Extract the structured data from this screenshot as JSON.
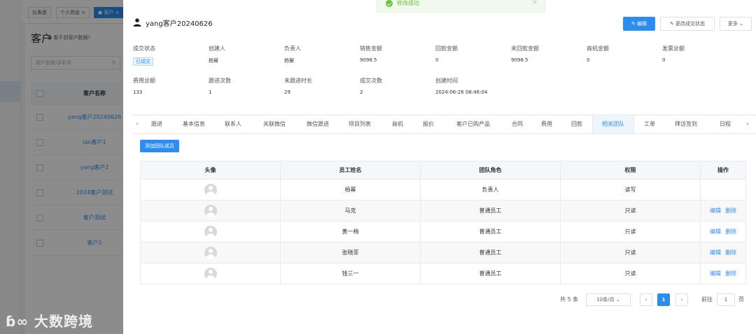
{
  "background": {
    "tabs": [
      "仪表盘",
      "个人信息",
      "客户"
    ],
    "page_title": "客户",
    "hint": "看不到客户数据?",
    "search_placeholder": "客户名称/手机号",
    "table_header": "客户名称",
    "rows": [
      "yang客户20240626",
      "lan客户1",
      "yang客户2",
      "2024客户测试",
      "客户测试",
      "客户1"
    ],
    "watermark": "大数跨境"
  },
  "toast": {
    "text": "修改成功"
  },
  "drawer": {
    "customer_name": "yang客户20240626",
    "buttons": {
      "edit": "编辑",
      "change_status": "更改成交状态",
      "more": "更多"
    },
    "info": [
      {
        "label": "成交状态",
        "value": "已成交",
        "tag": true
      },
      {
        "label": "创建人",
        "value": "杨幂"
      },
      {
        "label": "负责人",
        "value": "杨幂"
      },
      {
        "label": "销售金额",
        "value": "9098.5"
      },
      {
        "label": "回款金额",
        "value": "0"
      },
      {
        "label": "未回款金额",
        "value": "9098.5"
      },
      {
        "label": "商机金额",
        "value": "0"
      },
      {
        "label": "发票总额",
        "value": "0"
      },
      {
        "label": "费用总额",
        "value": "133"
      },
      {
        "label": "跟进次数",
        "value": "1"
      },
      {
        "label": "未跟进时长",
        "value": "29"
      },
      {
        "label": "成交次数",
        "value": "2"
      },
      {
        "label": "创建时间",
        "value": "2024-06-26 08:46:04"
      }
    ],
    "tabs": [
      "跟进",
      "基本信息",
      "联系人",
      "关联微信",
      "微信跟进",
      "项目列表",
      "商机",
      "报价",
      "客户已购产品",
      "合同",
      "费用",
      "回款",
      "相关团队",
      "工单",
      "拜访签到",
      "日程"
    ],
    "active_tab": "相关团队",
    "add_member_label": "添加团队成员",
    "table": {
      "headers": [
        "头像",
        "员工姓名",
        "团队角色",
        "权限",
        "操作"
      ],
      "rows": [
        {
          "name": "杨幂",
          "role": "负责人",
          "perm": "读写",
          "ops": false
        },
        {
          "name": "马克",
          "role": "普通员工",
          "perm": "只读",
          "ops": true
        },
        {
          "name": "黄一梅",
          "role": "普通员工",
          "perm": "只读",
          "ops": true
        },
        {
          "name": "张晓菲",
          "role": "普通员工",
          "perm": "只读",
          "ops": true
        },
        {
          "name": "钱三一",
          "role": "普通员工",
          "perm": "只读",
          "ops": true
        }
      ],
      "op_edit": "编辑",
      "op_delete": "删除"
    },
    "pagination": {
      "total": "共 5 条",
      "page_size": "10条/页",
      "current": "1",
      "goto_prefix": "前往",
      "goto_value": "1",
      "goto_suffix": "页"
    }
  }
}
